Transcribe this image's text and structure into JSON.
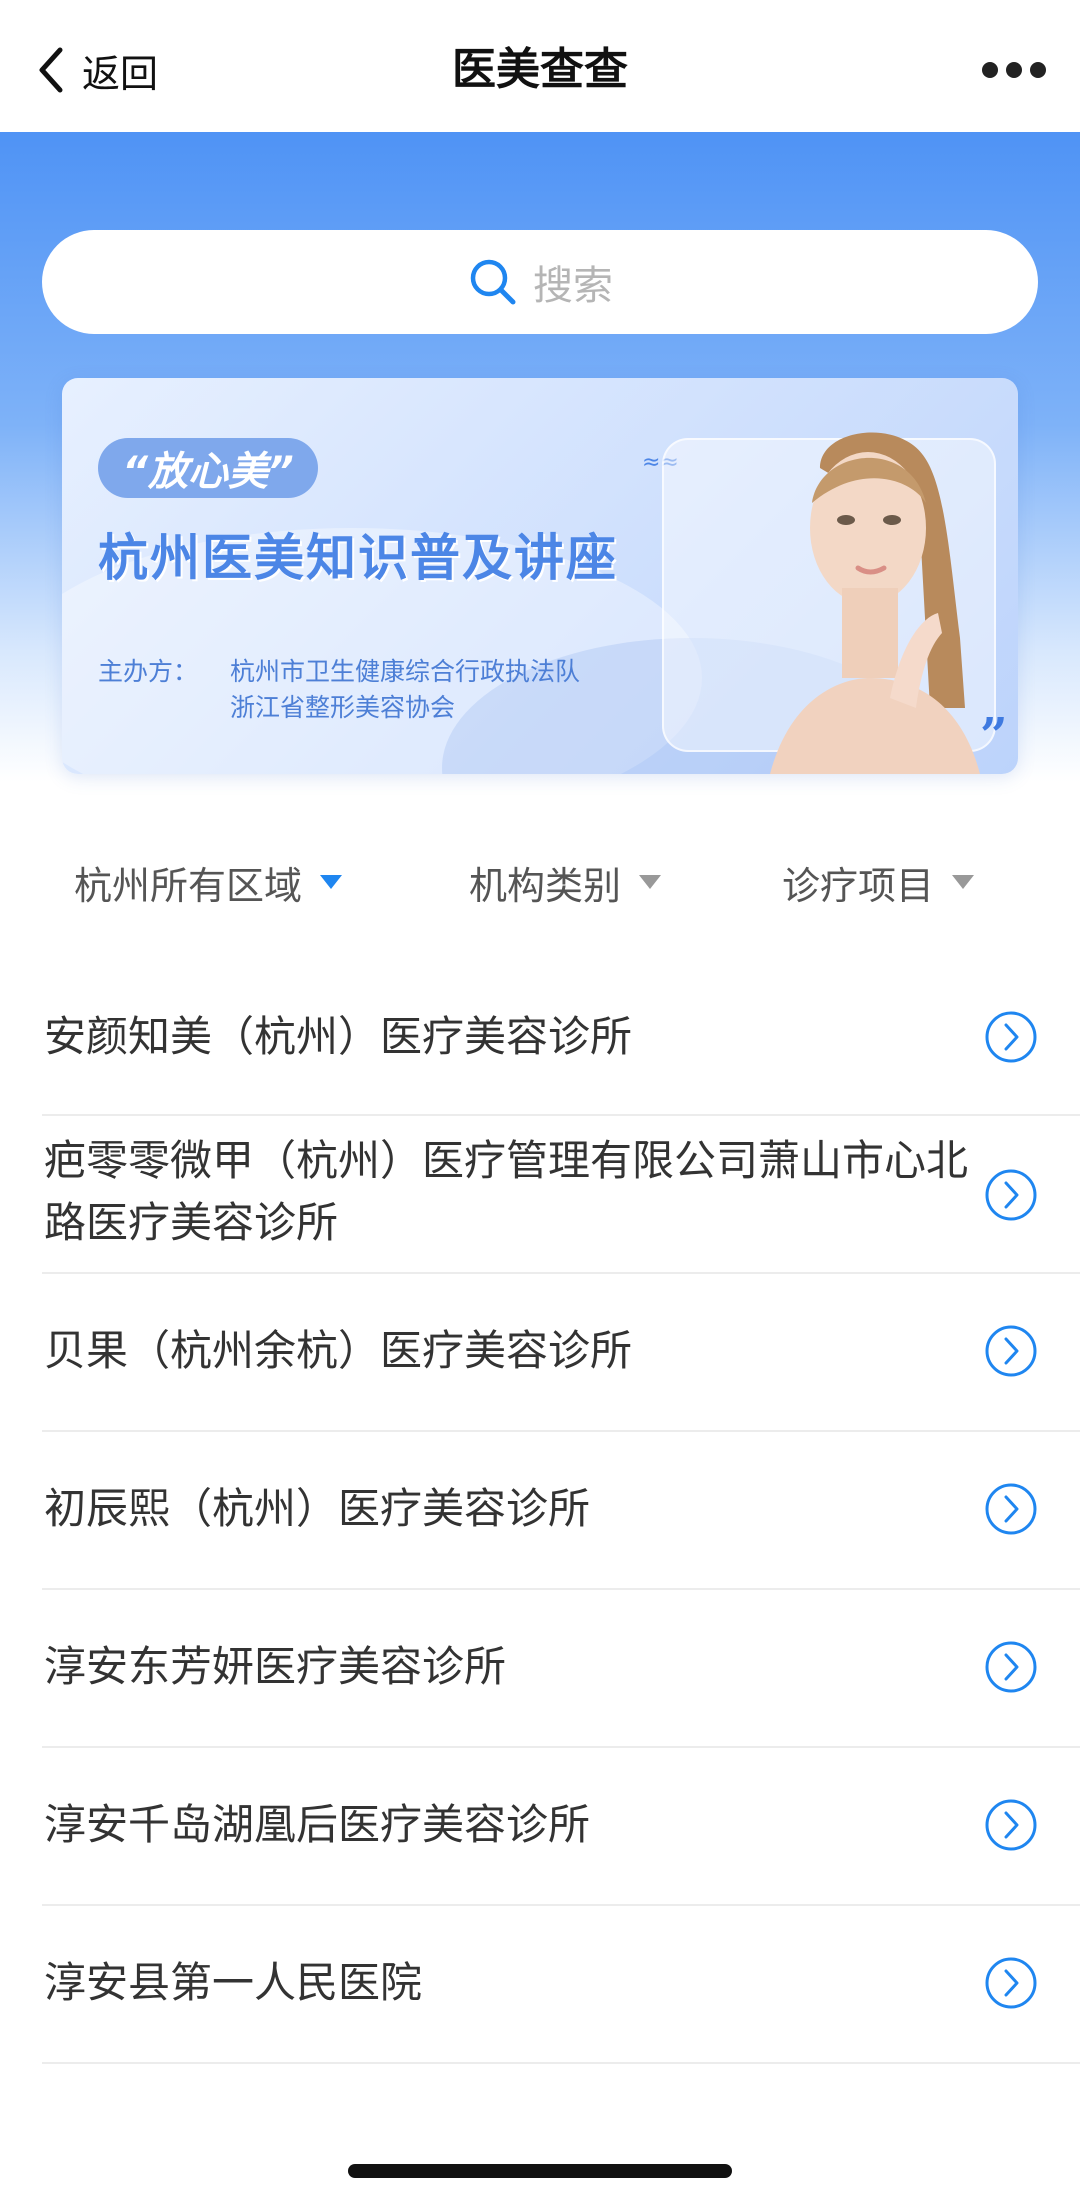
{
  "navbar": {
    "back_label": "返回",
    "title": "医美查查"
  },
  "search": {
    "placeholder": "搜索"
  },
  "banner": {
    "tag": "“放心美”",
    "title": "杭州医美知识普及讲座",
    "organizer_label": "主办方：",
    "organizers": [
      "杭州市卫生健康综合行政执法队",
      "浙江省整形美容协会"
    ]
  },
  "filters": [
    {
      "label": "杭州所有区域",
      "active": true
    },
    {
      "label": "机构类别",
      "active": false
    },
    {
      "label": "诊疗项目",
      "active": false
    }
  ],
  "clinics": [
    "安颜知美（杭州）医疗美容诊所",
    "疤零零微甲（杭州）医疗管理有限公司萧山市心北路医疗美容诊所",
    "贝果（杭州余杭）医疗美容诊所",
    "初辰熙（杭州）医疗美容诊所",
    "淳安东芳妍医疗美容诊所",
    "淳安千岛湖凰后医疗美容诊所",
    "淳安县第一人民医院"
  ],
  "colors": {
    "accent": "#1f86f0",
    "hero_top": "#4f93f5",
    "banner_title": "#4c86e6"
  },
  "icons": {
    "back": "chevron-left-icon",
    "more": "more-dots-icon",
    "search": "search-icon",
    "row_arrow": "chevron-right-circle-icon"
  }
}
